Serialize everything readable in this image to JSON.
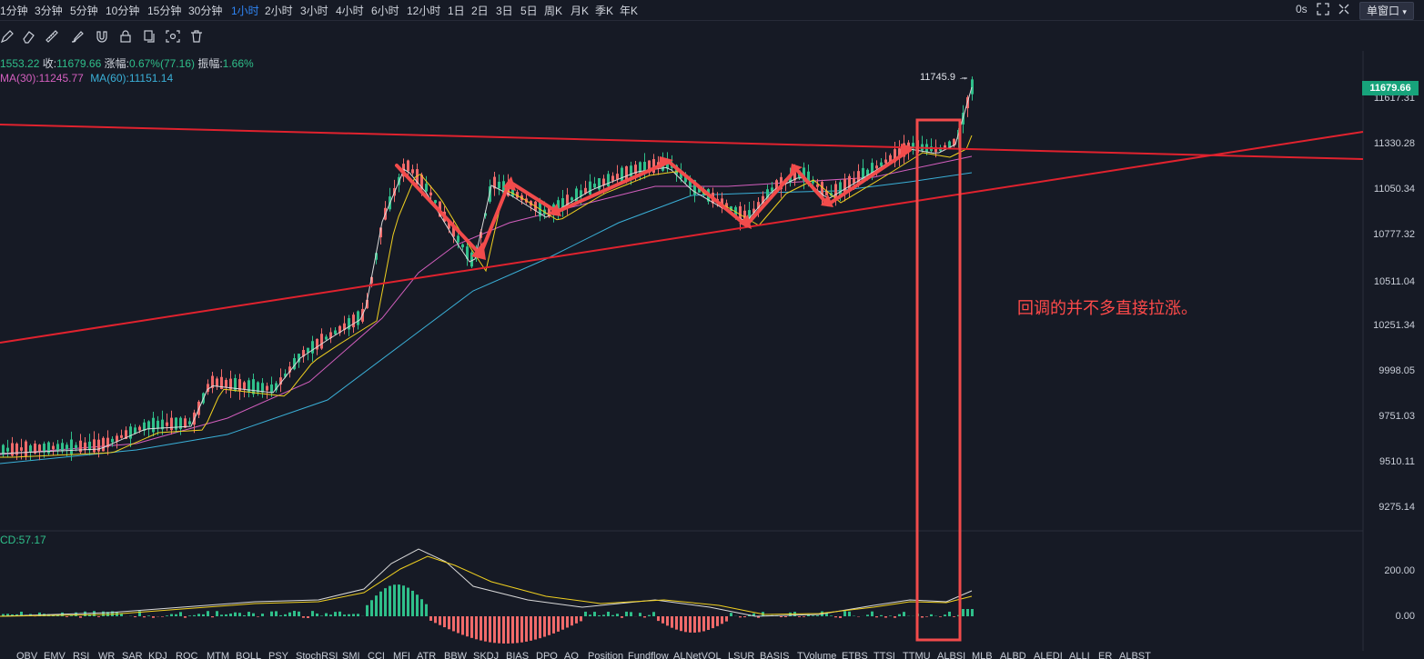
{
  "timeframes": [
    {
      "label": "1分钟",
      "active": false
    },
    {
      "label": "3分钟",
      "active": false
    },
    {
      "label": "5分钟",
      "active": false
    },
    {
      "label": "10分钟",
      "active": false
    },
    {
      "label": "15分钟",
      "active": false
    },
    {
      "label": "30分钟",
      "active": false
    },
    {
      "label": "1小时",
      "active": true
    },
    {
      "label": "2小时",
      "active": false
    },
    {
      "label": "3小时",
      "active": false
    },
    {
      "label": "4小时",
      "active": false
    },
    {
      "label": "6小时",
      "active": false
    },
    {
      "label": "12小时",
      "active": false
    },
    {
      "label": "1日",
      "active": false
    },
    {
      "label": "2日",
      "active": false
    },
    {
      "label": "3日",
      "active": false
    },
    {
      "label": "5日",
      "active": false
    },
    {
      "label": "周K",
      "active": false
    },
    {
      "label": "月K",
      "active": false
    },
    {
      "label": "季K",
      "active": false
    },
    {
      "label": "年K",
      "active": false
    }
  ],
  "top_right": {
    "countdown": "0s",
    "window_mode": "单窗口"
  },
  "toolbar_icons": [
    "pen-icon",
    "eraser-icon",
    "ruler-icon",
    "brush-icon",
    "magnet-icon",
    "lock-icon",
    "copy-icon",
    "screenshot-icon",
    "trash-icon"
  ],
  "ohlc": {
    "open_partial": "1553.22",
    "close_label": "收:",
    "close": "11679.66",
    "change_label": "涨幅:",
    "change": "0.67%(77.16)",
    "amp_label": "振幅:",
    "amp": "1.66%"
  },
  "ma": {
    "ma30": "MA(30):11245.77",
    "ma60": "MA(60):11151.14"
  },
  "macd": {
    "label": "CD:57.17"
  },
  "price_axis": {
    "ticks": [
      "11617.31",
      "11330.28",
      "11050.34",
      "10777.32",
      "10511.04",
      "10251.34",
      "9998.05",
      "9751.03",
      "9510.11",
      "9275.14"
    ],
    "current": "11679.66",
    "macd_ticks": [
      "200.00",
      "0.00"
    ]
  },
  "high_label": "11745.9",
  "annotation": "回调的并不多直接拉涨。",
  "bottom_tabs": [
    "OBV",
    "EMV",
    "RSI",
    "WR",
    "SAR",
    "KDJ",
    "ROC",
    "MTM",
    "BOLL",
    "PSY",
    "StochRSI",
    "SMI",
    "CCI",
    "MFI",
    "ATR",
    "BBW",
    "SKDJ",
    "BIAS",
    "DPO",
    "AO",
    "Position",
    "Fundflow",
    "ALNetVOL",
    "LSUR",
    "BASIS",
    "TVolume",
    "ETBS",
    "TTSI",
    "TTMU",
    "ALBSI",
    "MLB",
    "ALBD",
    "ALEDI",
    "ALLI",
    "ER",
    "ALBST"
  ],
  "colors": {
    "up": "#2fbf8a",
    "down": "#f06a6a",
    "trend": "#e0222e",
    "ma_short": "#d9d9d9",
    "ma_mid": "#f0d020",
    "ma30": "#d45fbf",
    "ma60": "#3ab0d8",
    "accent": "#2f86f6"
  }
}
